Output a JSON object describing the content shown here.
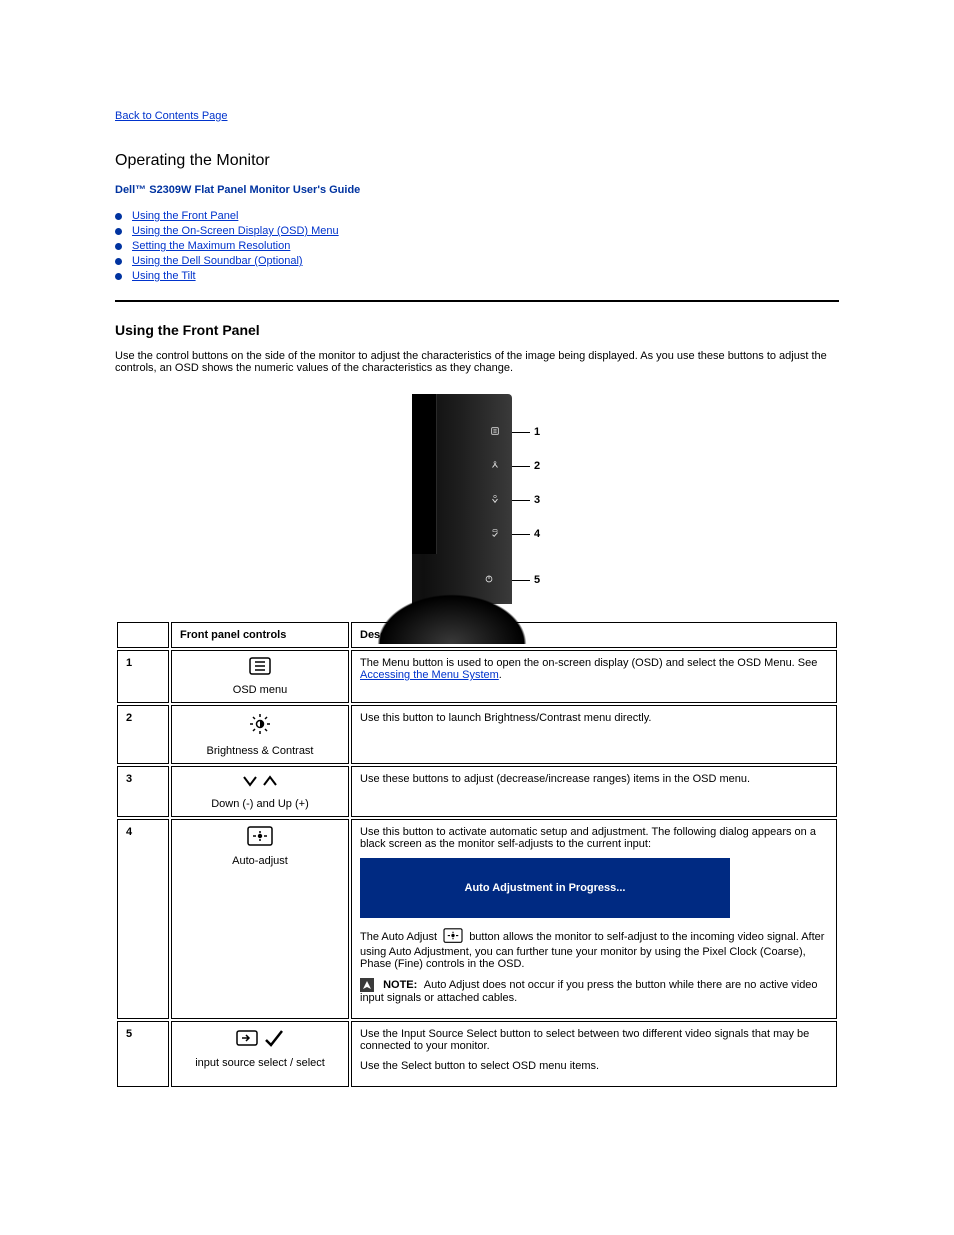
{
  "back_link": "Back to Contents Page",
  "title": "Operating the Monitor",
  "subtitle": "Dell™ S2309W Flat Panel Monitor User's Guide",
  "toc": [
    "Using the Front Panel",
    "Using the On-Screen Display (OSD) Menu",
    "Setting the Maximum Resolution",
    "Using the Dell Soundbar (Optional)",
    "Using the Tilt"
  ],
  "section_heading": "Using the Front Panel",
  "section_lead": "Use the control buttons on the side of the monitor to adjust the characteristics of the image being displayed. As you use these buttons to adjust the controls, an OSD shows the numeric values of the characteristics as they change.",
  "callouts": [
    "1",
    "2",
    "3",
    "4",
    "5"
  ],
  "table": {
    "headers": [
      "",
      "Front panel controls",
      "Description"
    ],
    "rows": [
      {
        "idx": "1",
        "ctrl_icon": "osd-menu-icon",
        "ctrl_label": "OSD menu",
        "desc_parts": {
          "prefix": "The Menu button is used to open the on-screen display (OSD) and select the OSD Menu. See ",
          "link": "Accessing the Menu System",
          "suffix": "."
        }
      },
      {
        "idx": "2",
        "ctrl_icon": "brightness-icon",
        "ctrl_label": "Brightness & Contrast",
        "desc": "Use this button to launch Brightness/Contrast menu directly."
      },
      {
        "idx": "3",
        "ctrl_icon": "down-up-icon",
        "ctrl_label": "Down (-) and Up (+)",
        "desc": "Use these buttons to adjust (decrease/increase ranges) items in the OSD menu."
      },
      {
        "idx": "4",
        "ctrl_icon": "auto-adjust-icon",
        "ctrl_label": "Auto-adjust",
        "desc_intro": "Use this button to activate automatic setup and adjustment. The following dialog appears on a black screen as the monitor self-adjusts to the current input:",
        "progress": "Auto Adjustment in Progress...",
        "desc_mid_before": "The Auto Adjust ",
        "desc_mid_after": " button allows the monitor to self-adjust to the incoming video signal. After using Auto Adjustment, you can further tune your monitor by using the Pixel Clock (Coarse), Phase (Fine) controls in the OSD.",
        "note_label": "NOTE:",
        "note_text": " Auto Adjust does not occur if you press the button while there are no active video input signals or attached cables."
      },
      {
        "idx": "5",
        "ctrl_icon": "enter-select-icon",
        "ctrl_label": "input source select / select",
        "desc_a": "Use the Input Source Select button to select between two different video signals that may be connected to your monitor.",
        "desc_b": "Use the Select button to select OSD menu items."
      }
    ]
  }
}
